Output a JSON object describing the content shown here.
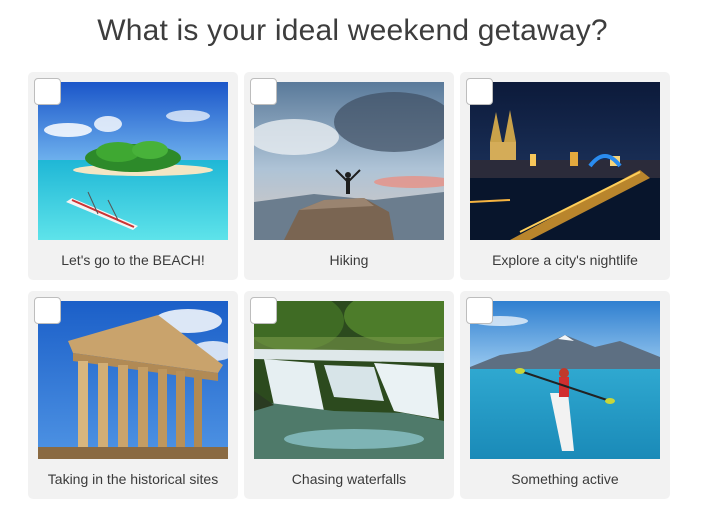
{
  "question": {
    "title": "What is your ideal weekend getaway?"
  },
  "options": [
    {
      "label": "Let's go to the BEACH!",
      "checked": false
    },
    {
      "label": "Hiking",
      "checked": false
    },
    {
      "label": "Explore a city's nightlife",
      "checked": false
    },
    {
      "label": "Taking in the historical sites",
      "checked": false
    },
    {
      "label": "Chasing waterfalls",
      "checked": false
    },
    {
      "label": "Something active",
      "checked": false
    }
  ],
  "colors": {
    "card_background": "#f2f2f2",
    "checkbox_border": "#bdbdbd",
    "text": "#3a3a3a"
  }
}
